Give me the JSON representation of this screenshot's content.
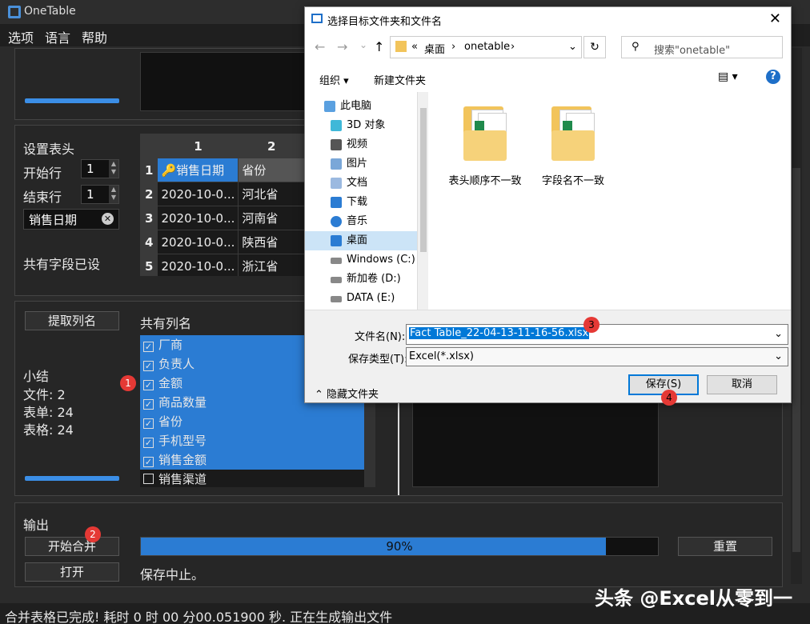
{
  "app": {
    "title": "OneTable"
  },
  "menu": [
    "选项",
    "语言",
    "帮助"
  ],
  "header_section": {
    "title": "设置表头",
    "start_row_label": "开始行",
    "start_row_value": "1",
    "end_row_label": "结束行",
    "end_row_value": "1",
    "selected_field": "销售日期",
    "common_fields_set": "共有字段已设"
  },
  "grid": {
    "col_headers": [
      "1",
      "2"
    ],
    "rows": [
      {
        "n": "1",
        "c1": "销售日期",
        "c2": "省份"
      },
      {
        "n": "2",
        "c1": "2020-10-0...",
        "c2": "河北省"
      },
      {
        "n": "3",
        "c1": "2020-10-0...",
        "c2": "河南省"
      },
      {
        "n": "4",
        "c1": "2020-10-0...",
        "c2": "陕西省"
      },
      {
        "n": "5",
        "c1": "2020-10-0...",
        "c2": "浙江省"
      }
    ]
  },
  "columns_section": {
    "extract_button": "提取列名",
    "list_title": "共有列名",
    "items": [
      {
        "label": "厂商",
        "checked": true
      },
      {
        "label": "负责人",
        "checked": true
      },
      {
        "label": "金额",
        "checked": true
      },
      {
        "label": "商品数量",
        "checked": true
      },
      {
        "label": "省份",
        "checked": true
      },
      {
        "label": "手机型号",
        "checked": true
      },
      {
        "label": "销售金额",
        "checked": true
      },
      {
        "label": "销售渠道",
        "checked": false
      }
    ],
    "summary_title": "小结",
    "summary_files": "文件: 2",
    "summary_sheets": "表单: 24",
    "summary_tables": "表格: 24"
  },
  "output_section": {
    "title": "输出",
    "merge_button": "开始合并",
    "open_button": "打开",
    "progress_label": "90%",
    "progress": 0.9,
    "reset_button": "重置",
    "status": "保存中止。"
  },
  "statusbar": "合并表格已完成! 耗时 0 时 00 分00.051900 秒. 正在生成输出文件",
  "badges": [
    "1",
    "2",
    "3",
    "4"
  ],
  "dialog": {
    "title": "选择目标文件夹和文件名",
    "breadcrumb_prefix": "«",
    "breadcrumb": [
      "桌面",
      "onetable"
    ],
    "search_placeholder": "搜索\"onetable\"",
    "organize": "组织 ▾",
    "new_folder": "新建文件夹",
    "tree": [
      {
        "label": "此电脑",
        "icon": "computer-icon"
      },
      {
        "label": "3D 对象",
        "icon": "cube-icon"
      },
      {
        "label": "视频",
        "icon": "video-icon"
      },
      {
        "label": "图片",
        "icon": "picture-icon"
      },
      {
        "label": "文档",
        "icon": "document-icon"
      },
      {
        "label": "下载",
        "icon": "download-icon"
      },
      {
        "label": "音乐",
        "icon": "music-icon"
      },
      {
        "label": "桌面",
        "icon": "desktop-icon"
      },
      {
        "label": "Windows (C:)",
        "icon": "drive-icon"
      },
      {
        "label": "新加卷 (D:)",
        "icon": "drive-icon"
      },
      {
        "label": "DATA (E:)",
        "icon": "drive-icon"
      }
    ],
    "folders": [
      "表头顺序不一致",
      "字段名不一致"
    ],
    "filename_label": "文件名(N):",
    "filename_value": "Fact Table_22-04-13-11-16-56.xlsx",
    "filetype_label": "保存类型(T):",
    "filetype_value": "Excel(*.xlsx)",
    "hide_folders": "隐藏文件夹",
    "save_button": "保存(S)",
    "cancel_button": "取消"
  },
  "watermark": "头条 @Excel从零到一"
}
